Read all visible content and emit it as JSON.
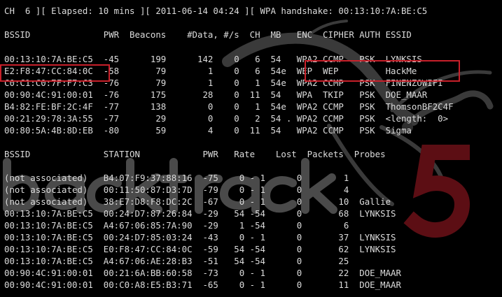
{
  "wallpaper": {
    "brand": "backtrack",
    "version": "5",
    "logo_icon": "dragon-icon"
  },
  "status_line": "CH  6 ][ Elapsed: 10 mins ][ 2011-06-14 04:24 ][ WPA handshake: 00:13:10:7A:BE:C5",
  "ap_table": {
    "header": "BSSID              PWR  Beacons    #Data, #/s  CH  MB   ENC  CIPHER AUTH ESSID",
    "rows": [
      "00:13:10:7A:BE:C5  -45      199      142    0   6  54   WPA2 CCMP   PSK  LYNKSIS",
      "E2:F8:47:CC:84:0C  -58       79        1    0   6  54e  WEP  WEP         HackMe",
      "C0:C1:C0:7F:F7:C3  -76       79        1    0   1  54e  WPA2 CCMP   PSK  FINENZOWIFI",
      "00:90:4C:91:00:01  -76      175       28    0  11  54   WPA  TKIP   PSK  DOE_MAAR",
      "B4:82:FE:BF:2C:4F  -77      138        0    0   1  54e  WPA2 CCMP   PSK  ThomsonBF2C4F",
      "00:21:29:78:3A:55  -77       29        0    0   2  54 . WPA2 CCMP   PSK  <length:  0>",
      "00:80:5A:4B:8D:EB  -80       59        4    0  11  54   WPA2 CCMP   PSK  Sigma"
    ]
  },
  "station_table": {
    "header": "BSSID              STATION            PWR   Rate    Lost  Packets  Probes",
    "rows": [
      "(not associated)   B4:07:F9:37:88:16  -75    0 - 1      0        1",
      "(not associated)   00:11:50:87:D3:7D  -79    0 - 1      0        4",
      "(not associated)   38:E7:D8:F8:DC:2C  -67    0 - 1      0       10  Gallie",
      "00:13:10:7A:BE:C5  00:24:D7:87:26:84  -29   54 -54      0       68  LYNKSIS",
      "00:13:10:7A:BE:C5  A4:67:06:85:7A:90  -29    1 -54      0        6",
      "00:13:10:7A:BE:C5  00:24:D7:85:03:24  -43    0 - 1      0       37  LYNKSIS",
      "00:13:10:7A:BE:C5  E0:F8:47:CC:84:0C  -59   54 -54      0       62  LYNKSIS",
      "00:13:10:7A:BE:C5  A4:67:06:AE:28:B3  -51   54 -54      0       25",
      "00:90:4C:91:00:01  00:21:6A:BB:60:58  -73    0 - 1      0       22  DOE_MAAR",
      "00:90:4C:91:00:01  00:C0:A8:E5:B3:71  -65    0 - 1      0       11  DOE_MAAR"
    ]
  },
  "highlight_color": "#c8202a"
}
